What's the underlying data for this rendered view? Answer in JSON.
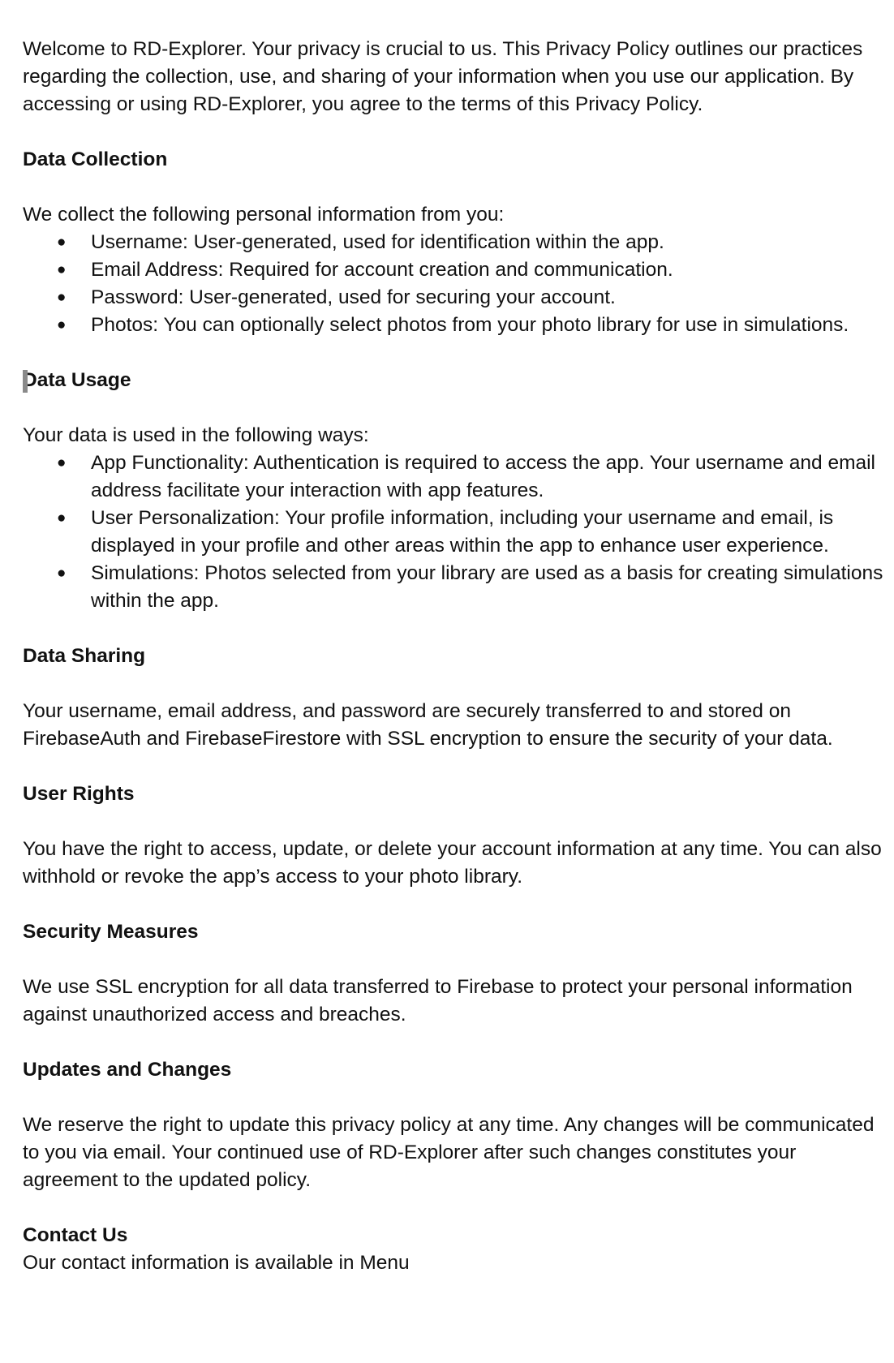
{
  "intro": "Welcome to RD-Explorer. Your privacy is crucial to us. This Privacy Policy outlines our practices regarding the collection, use, and sharing of your information when you use our application. By accessing or using RD-Explorer, you agree to the terms of this Privacy Policy.",
  "data_collection": {
    "heading": "Data Collection",
    "lead": "We collect the following personal information from you:",
    "items": [
      "Username: User-generated, used for identification within the app.",
      "Email Address: Required for account creation and communication.",
      "Password: User-generated, used for securing your account.",
      "Photos: You can optionally select photos from your photo library for use in simulations."
    ]
  },
  "data_usage": {
    "heading": "Data Usage",
    "lead": "Your data is used in the following ways:",
    "items": [
      "App Functionality: Authentication is required to access the app. Your username and email address facilitate your interaction with app features.",
      "User Personalization: Your profile information, including your username and email, is displayed in your profile and other areas within the app to enhance user experience.",
      "Simulations: Photos selected from your library are used as a basis for creating simulations within the app."
    ]
  },
  "data_sharing": {
    "heading": "Data Sharing",
    "body": "Your username, email address, and password are securely transferred to and stored on FirebaseAuth and FirebaseFirestore with SSL encryption to ensure the security of your data."
  },
  "user_rights": {
    "heading": "User Rights",
    "body": "You have the right to access, update, or delete your account information at any time. You can also withhold or revoke the app’s access to your photo library."
  },
  "security": {
    "heading": "Security Measures",
    "body": "We use SSL encryption for all data transferred to Firebase to protect your personal information against unauthorized access and breaches."
  },
  "updates": {
    "heading": "Updates and Changes",
    "body": "We reserve the right to update this privacy policy at any time. Any changes will be communicated to you via email. Your continued use of RD-Explorer after such changes constitutes your agreement to the updated policy."
  },
  "contact": {
    "heading": "Contact Us",
    "body": "Our contact information is available in Menu"
  }
}
